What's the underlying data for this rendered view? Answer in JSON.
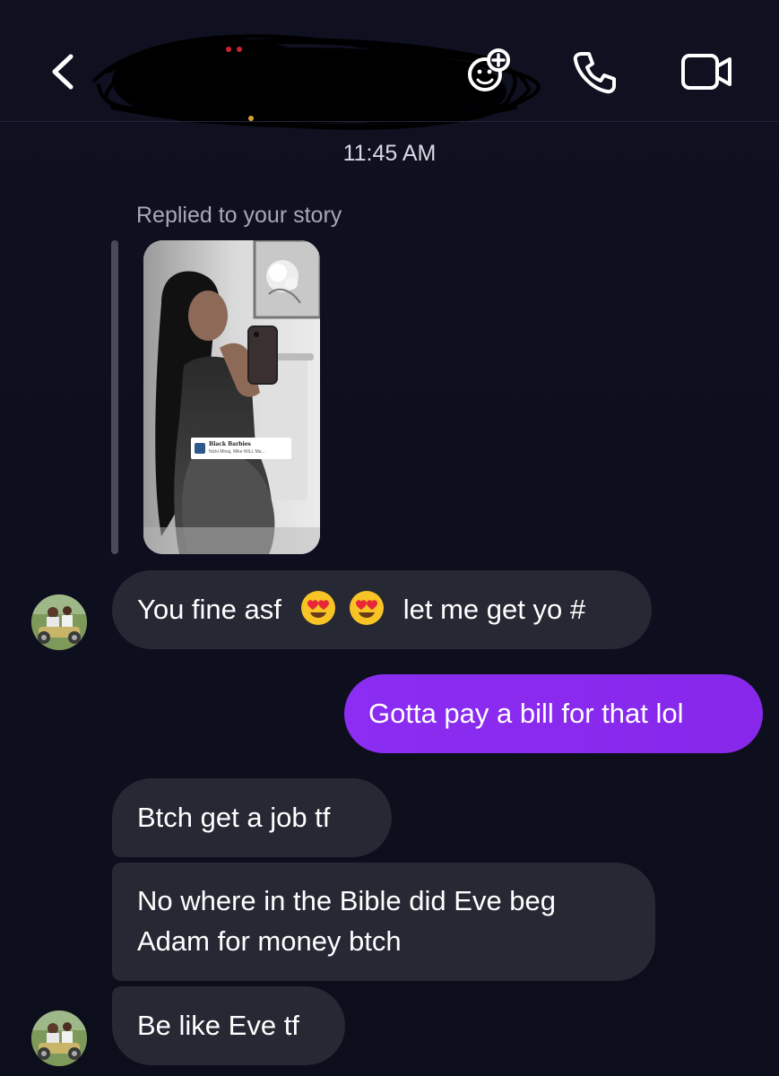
{
  "header": {
    "back_icon": "chevron-left-icon",
    "contact_name_redacted": true,
    "actions": [
      {
        "name": "add-person-icon"
      },
      {
        "name": "phone-icon"
      },
      {
        "name": "video-camera-icon"
      }
    ]
  },
  "thread": {
    "timestamp": "11:45 AM",
    "story_reply": {
      "caption": "Replied to your story",
      "music_sticker": {
        "title": "Black Barbies",
        "artist": "Nicki Minaj, Mike WiLL Ma..."
      }
    },
    "messages": [
      {
        "sender": "them",
        "text_before": "You fine asf",
        "emoji": [
          "heart-eyes-emoji",
          "heart-eyes-emoji"
        ],
        "text_after": "let me get yo #"
      },
      {
        "sender": "me",
        "text": "Gotta pay a bill for that lol"
      },
      {
        "sender": "them",
        "text": "Btch get a job tf"
      },
      {
        "sender": "them",
        "lines": [
          "No where in the Bible did Eve beg",
          "Adam for money btch"
        ]
      },
      {
        "sender": "them",
        "text": "Be like Eve tf"
      }
    ]
  },
  "colors": {
    "background": "#0e0f1e",
    "incoming_bubble": "#262834",
    "outgoing_bubble": "#8b2df2",
    "secondary_text": "#a7a9b6"
  }
}
